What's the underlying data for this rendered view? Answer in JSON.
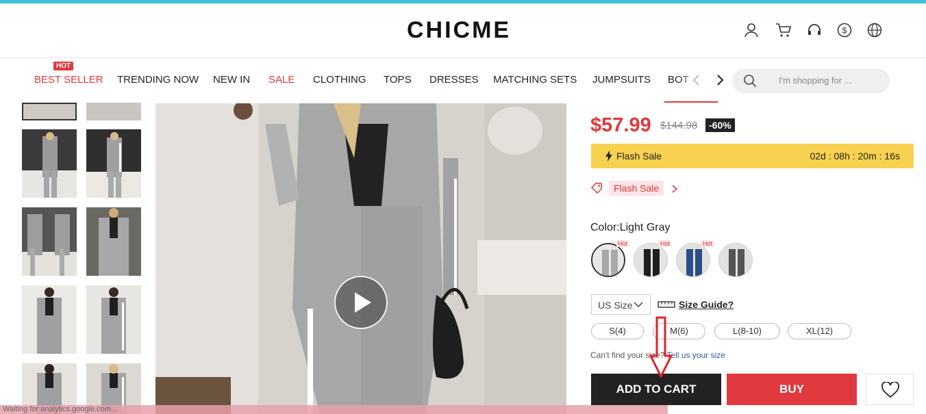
{
  "header": {
    "logo": "CHICME"
  },
  "nav": {
    "hot_badge": "HOT",
    "items": [
      {
        "label": "BEST SELLER"
      },
      {
        "label": "TRENDING NOW"
      },
      {
        "label": "NEW IN"
      },
      {
        "label": "SALE"
      },
      {
        "label": "CLOTHING"
      },
      {
        "label": "TOPS"
      },
      {
        "label": "DRESSES"
      },
      {
        "label": "MATCHING SETS"
      },
      {
        "label": "JUMPSUITS"
      },
      {
        "label": "BOT"
      }
    ],
    "search_placeholder": "I'm shopping for ..."
  },
  "product": {
    "price": "$57.99",
    "original_price": "$144.98",
    "discount": "-60%",
    "flash_sale_label": "Flash Sale",
    "countdown": "02d : 08h : 20m : 16s",
    "flash_sale_tag": "Flash Sale",
    "color_label": "Color:Light Gray",
    "swatch_hot": "Hot",
    "size_unit": "US Size",
    "size_guide": "Size Guide?",
    "sizes": [
      "S(4)",
      "M(6)",
      "L(8-10)",
      "XL(12)"
    ],
    "cant_find": "Can't find your size?",
    "tell_us": "Tell us your size",
    "add_to_cart": "ADD TO CART",
    "buy": "BUY"
  },
  "status_bar": "Waiting for analytics.google.com...",
  "colors": {
    "accent_red": "#e0393e",
    "flash_yellow": "#f8d150",
    "top_bar": "#3cc2d8"
  }
}
